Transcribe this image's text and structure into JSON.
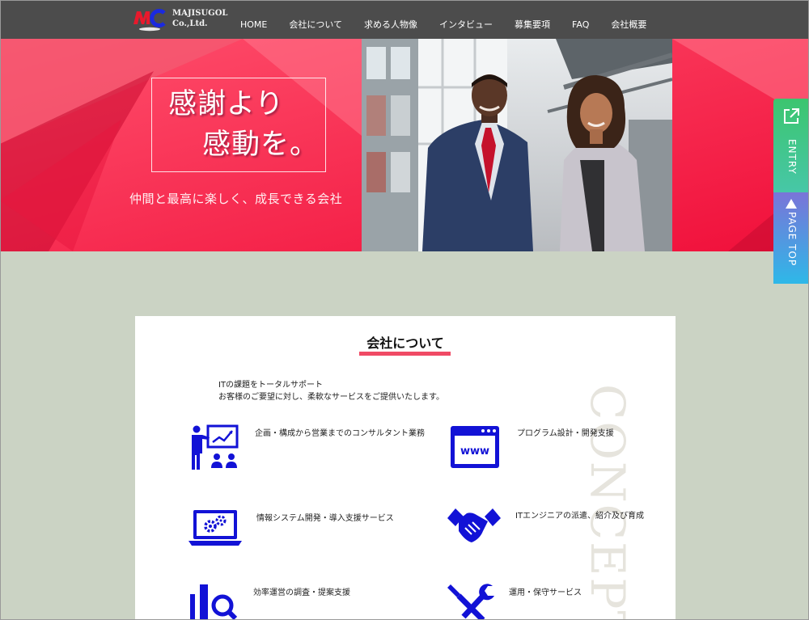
{
  "header": {
    "logo_line1": "MAJISUGOL",
    "logo_line2": "Co.,Ltd.",
    "nav": [
      "HOME",
      "会社について",
      "求める人物像",
      "インタビュー",
      "募集要項",
      "FAQ",
      "会社概要"
    ]
  },
  "hero": {
    "title_line1": "感謝より",
    "title_line2": "感動を。",
    "tagline": "仲間と最高に楽しく、成長できる会社"
  },
  "side": {
    "entry": "ENTRY",
    "page_top": "PAGE TOP"
  },
  "about": {
    "title": "会社について",
    "intro_line1": "ITの課題をトータルサポート",
    "intro_line2": "お客様のご要望に対し、柔軟なサービスをご提供いたします。",
    "watermark": "CONCEPT",
    "services": [
      {
        "label": "企画・構成から営業までのコンサルタント業務",
        "icon": "presentation-icon"
      },
      {
        "label": "プログラム設計・開発支援",
        "icon": "browser-www-icon"
      },
      {
        "label": "情報システム開発・導入支援サービス",
        "icon": "laptop-gears-icon"
      },
      {
        "label": "ITエンジニアの派遣、紹介及び育成",
        "icon": "handshake-icon"
      },
      {
        "label": "効率運営の調査・提案支援",
        "icon": "analysis-chart-icon"
      },
      {
        "label": "運用・保守サービス",
        "icon": "tools-icon"
      }
    ]
  },
  "colors": {
    "header_bg": "#4c4c4c",
    "hero_red": "#f0103a",
    "accent_underline": "#f04a65",
    "icon_blue": "#1212d6",
    "entry_green": "#3cc56f",
    "page_top_blue": "#2eb8e8",
    "page_bg": "#cbd3c4"
  }
}
